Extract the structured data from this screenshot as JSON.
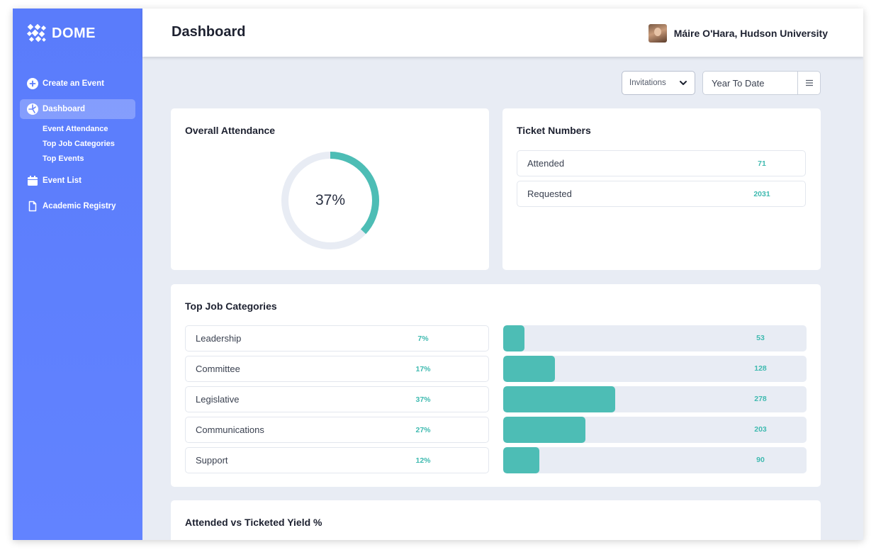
{
  "brand": {
    "name": "DOME",
    "logo_icon": "dome-logo-icon"
  },
  "colors": {
    "sidebar": "#5a7cfb",
    "accent": "#4dbdb5",
    "accent_text": "#3fbab0",
    "background": "#e8ecf4"
  },
  "sidebar": {
    "items": [
      {
        "label": "Create an Event",
        "icon": "plus-circle-icon"
      },
      {
        "label": "Dashboard",
        "icon": "dashboard-icon",
        "active": true,
        "subitems": [
          "Event Attendance",
          "Top Job Categories",
          "Top Events"
        ]
      },
      {
        "label": "Event List",
        "icon": "calendar-icon"
      },
      {
        "label": "Academic Registry",
        "icon": "document-icon"
      }
    ]
  },
  "header": {
    "title": "Dashboard",
    "user": "Máire O'Hara, Hudson University"
  },
  "filters": {
    "type_selected": "Invitations",
    "date_range": "Year To Date"
  },
  "attendance": {
    "title": "Overall Attendance",
    "percent_label": "37%",
    "percent": 37
  },
  "tickets": {
    "title": "Ticket Numbers",
    "rows": [
      {
        "label": "Attended",
        "value": "71"
      },
      {
        "label": "Requested",
        "value": "2031"
      }
    ]
  },
  "jobs": {
    "title": "Top Job Categories",
    "rows": [
      {
        "label": "Leadership",
        "pct": "7%",
        "value": "53",
        "fraction": 0.07
      },
      {
        "label": "Committee",
        "pct": "17%",
        "value": "128",
        "fraction": 0.17
      },
      {
        "label": "Legislative",
        "pct": "37%",
        "value": "278",
        "fraction": 0.37
      },
      {
        "label": "Communications",
        "pct": "27%",
        "value": "203",
        "fraction": 0.27
      },
      {
        "label": "Support",
        "pct": "12%",
        "value": "90",
        "fraction": 0.12
      }
    ]
  },
  "yield": {
    "title": "Attended vs Ticketed Yield %"
  }
}
